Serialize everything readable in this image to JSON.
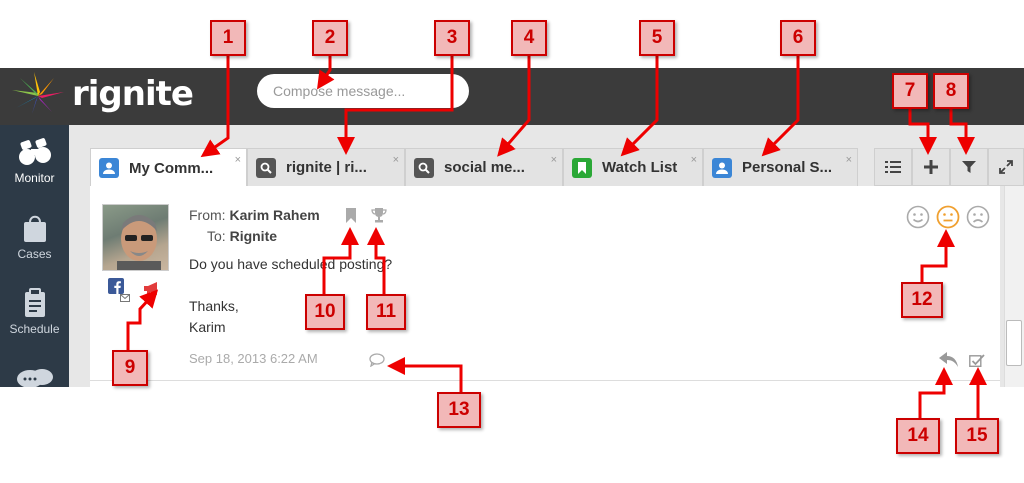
{
  "app": {
    "logo_text": "rignite"
  },
  "compose": {
    "placeholder": "Compose message..."
  },
  "sidebar": {
    "items": [
      {
        "label": "Monitor",
        "icon": "binoculars-icon"
      },
      {
        "label": "Cases",
        "icon": "shopping-bag-icon"
      },
      {
        "label": "Schedule",
        "icon": "clipboard-icon"
      },
      {
        "label": "",
        "icon": "chat-bubbles-icon"
      }
    ]
  },
  "tabs": [
    {
      "label": "My Comm...",
      "icon": "person-icon",
      "color": "#3b86d6"
    },
    {
      "label": "rignite | ri...",
      "icon": "search-icon",
      "color": "#555555"
    },
    {
      "label": "social me...",
      "icon": "search-icon",
      "color": "#555555"
    },
    {
      "label": "Watch List",
      "icon": "bookmark-icon",
      "color": "#2aa836"
    },
    {
      "label": "Personal S...",
      "icon": "person-icon",
      "color": "#3b86d6"
    }
  ],
  "tab_close": "×",
  "message": {
    "from_label": "From:",
    "from_name": "Karim Rahem",
    "to_label": "To:",
    "to_name": "Rignite",
    "body": "Do you have scheduled posting?",
    "signoff": "Thanks,",
    "signature": "Karim",
    "date": "Sep 18, 2013 6:22 AM"
  },
  "accent_color": "#f0a030",
  "callouts": [
    "1",
    "2",
    "3",
    "4",
    "5",
    "6",
    "7",
    "8",
    "9",
    "10",
    "11",
    "12",
    "13",
    "14",
    "15"
  ]
}
